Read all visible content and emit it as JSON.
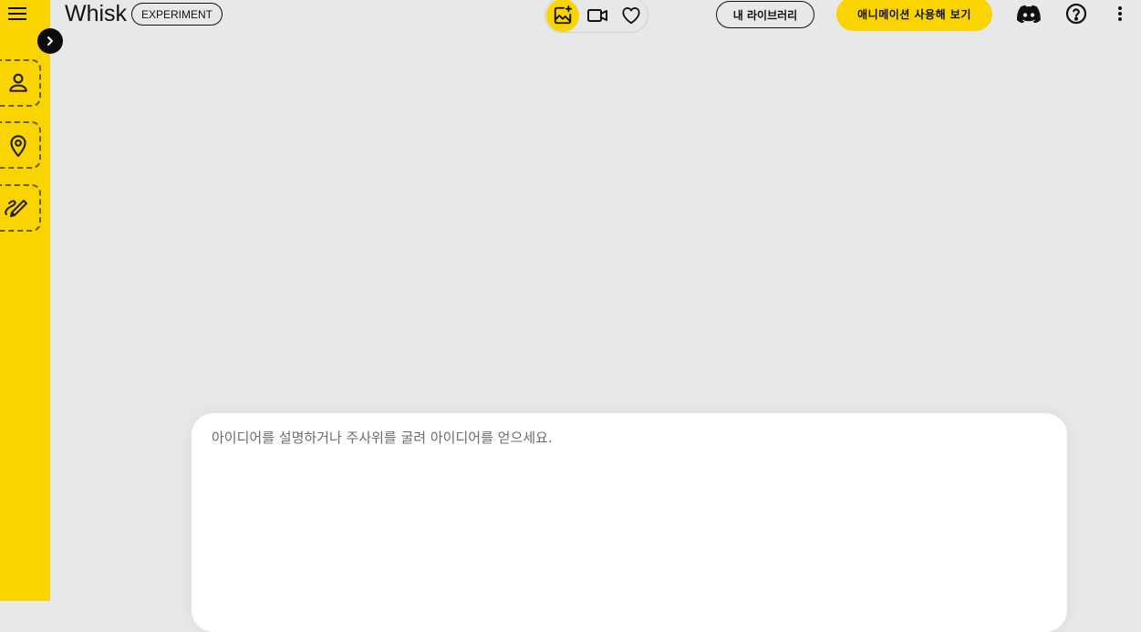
{
  "app": {
    "brand": "Whisk",
    "badge": "EXPERIMENT"
  },
  "sidebar": {
    "slots": [
      {
        "icon": "person-icon"
      },
      {
        "icon": "location-pin-icon"
      },
      {
        "icon": "brush-icon"
      }
    ]
  },
  "mode_toggle": {
    "items": [
      {
        "icon": "image-add-icon",
        "active": true
      },
      {
        "icon": "video-camera-icon",
        "active": false
      },
      {
        "icon": "heart-icon",
        "active": false
      }
    ]
  },
  "header": {
    "library_label": "내 라이브러리",
    "animation_label": "애니메이션 사용해 보기"
  },
  "prompt": {
    "placeholder": "아이디어를 설명하거나 주사위를 굴려 아이디어를 얻으세요.",
    "value": ""
  },
  "colors": {
    "accent": "#fad400",
    "background": "#e8e8e8",
    "card": "#ffffff"
  }
}
